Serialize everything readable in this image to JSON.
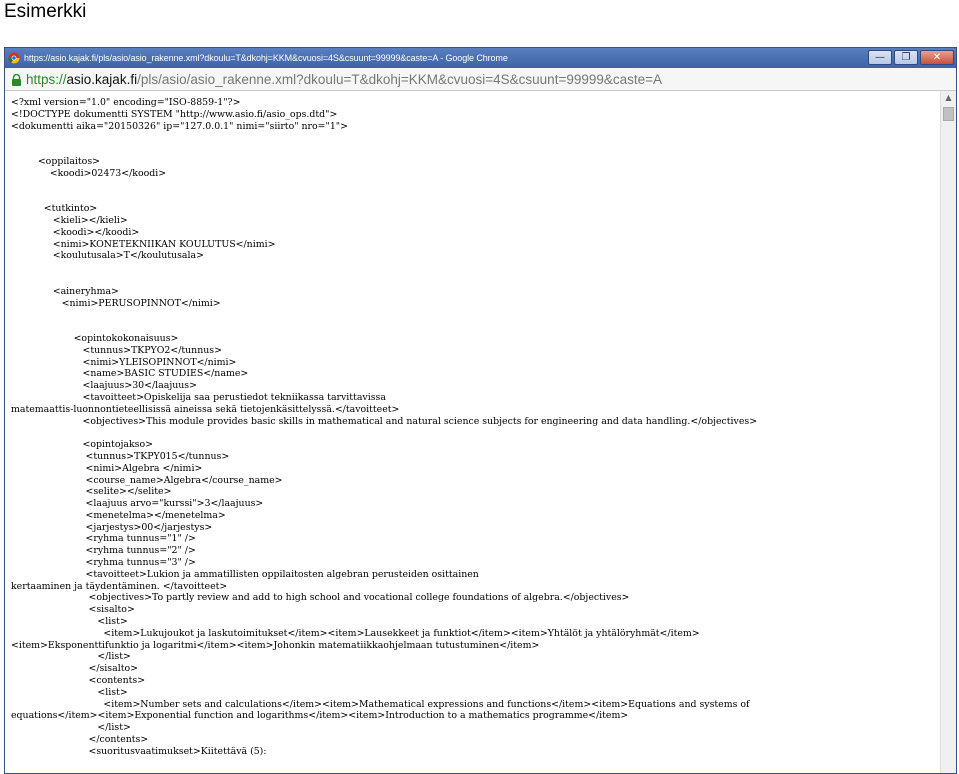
{
  "caption": "Esimerkki",
  "window": {
    "title": "https://asio.kajak.fi/pls/asio/asio_rakenne.xml?dkoulu=T&dkohj=KKM&cvuosi=4S&csuunt=99999&caste=A - Google Chrome",
    "minimize_label": "—",
    "restore_label": "❐",
    "close_label": "✕"
  },
  "address": {
    "scheme": "https://",
    "host": "asio.kajak.fi",
    "rest": "/pls/asio/asio_rakenne.xml?dkoulu=T&dkohj=KKM&cvuosi=4S&csuunt=99999&caste=A"
  },
  "xml_lines": [
    "<?xml version=\"1.0\" encoding=\"ISO-8859-1\"?>",
    "<!DOCTYPE dokumentti SYSTEM \"http://www.asio.fi/asio_ops.dtd\">",
    "<dokumentti aika=\"20150326\" ip=\"127.0.0.1\" nimi=\"siirto\" nro=\"1\">",
    "",
    "",
    "         <oppilaitos>",
    "             <koodi>02473</koodi>",
    "",
    "",
    "           <tutkinto>",
    "              <kieli></kieli>",
    "              <koodi></koodi>",
    "              <nimi>KONETEKNIIKAN KOULUTUS</nimi>",
    "              <koulutusala>T</koulutusala>",
    "",
    "",
    "              <aineryhma>",
    "                 <nimi>PERUSOPINNOT</nimi>",
    "",
    "",
    "                     <opintokokonaisuus>",
    "                        <tunnus>TKPYO2</tunnus>",
    "                        <nimi>YLEISOPINNOT</nimi>",
    "                        <name>BASIC STUDIES</name>",
    "                        <laajuus>30</laajuus>",
    "                        <tavoitteet>Opiskelija saa perustiedot tekniikassa tarvittavissa",
    "matemaattis-luonnontieteellisissä aineissa sekä tietojenkäsittelyssä.</tavoitteet>",
    "                        <objectives>This module provides basic skills in mathematical and natural science subjects for engineering and data handling.</objectives>",
    "",
    "                        <opintojakso>",
    "                         <tunnus>TKPY015</tunnus>",
    "                         <nimi>Algebra </nimi>",
    "                         <course_name>Algebra</course_name>",
    "                         <selite></selite>",
    "                         <laajuus arvo=\"kurssi\">3</laajuus>",
    "                         <menetelma></menetelma>",
    "                         <jarjestys>00</jarjestys>",
    "                         <ryhma tunnus=\"1\" />",
    "                         <ryhma tunnus=\"2\" />",
    "                         <ryhma tunnus=\"3\" />",
    "                         <tavoitteet>Lukion ja ammatillisten oppilaitosten algebran perusteiden osittainen",
    "kertaaminen ja täydentäminen. </tavoitteet>",
    "                          <objectives>To partly review and add to high school and vocational college foundations of algebra.</objectives>",
    "                          <sisalto>",
    "                             <list>",
    "                               <item>Lukujoukot ja laskutoimitukset</item><item>Lausekkeet ja funktiot</item><item>Yhtälöt ja yhtälöryhmät</item>",
    "<item>Eksponenttifunktio ja logaritmi</item><item>Johonkin matematiikkaohjelmaan tutustuminen</item>",
    "                             </list>",
    "                          </sisalto>",
    "                          <contents>",
    "                             <list>",
    "                               <item>Number sets and calculations</item><item>Mathematical expressions and functions</item><item>Equations and systems of",
    "equations</item><item>Exponential function and logarithms</item><item>Introduction to a mathematics programme</item>",
    "                             </list>",
    "                          </contents>",
    "                          <suoritusvaatimukset>Kiitettävä (5):"
  ]
}
